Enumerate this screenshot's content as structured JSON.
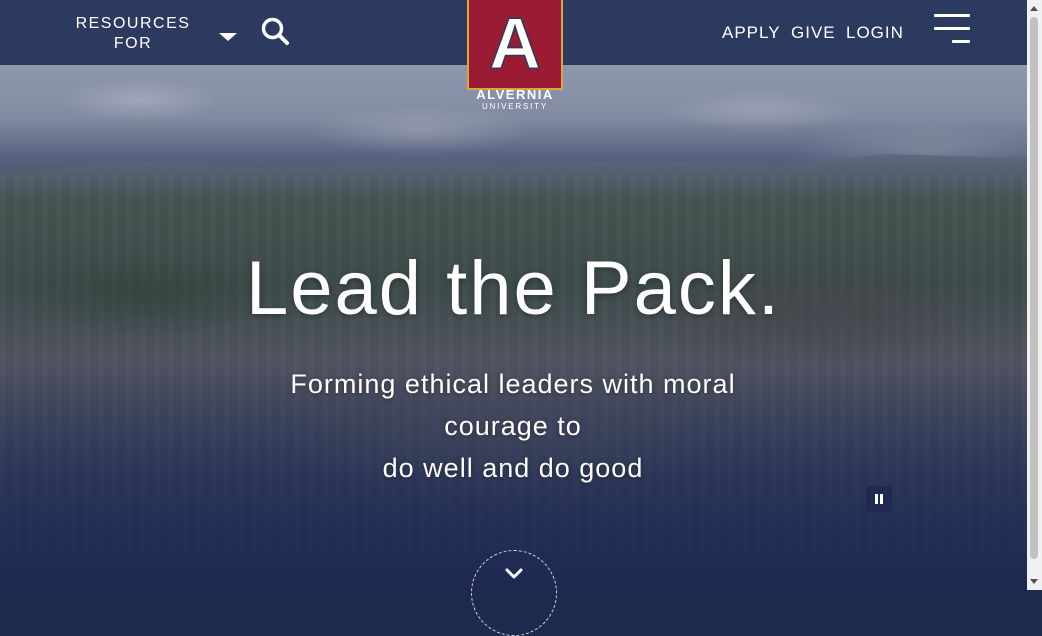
{
  "header": {
    "resources_label": "RESOURCES FOR",
    "nav": [
      {
        "label": "APPLY"
      },
      {
        "label": "GIVE"
      },
      {
        "label": "LOGIN"
      }
    ]
  },
  "logo": {
    "letter": "A",
    "name": "ALVERNIA",
    "subtitle": "UNIVERSITY",
    "colors": {
      "box": "#9b1b32",
      "border": "#d8a93a"
    }
  },
  "hero": {
    "headline": "Lead the Pack.",
    "tagline_line1": "Forming ethical leaders with moral",
    "tagline_line2": "courage to",
    "tagline_line3": "do well and do good"
  },
  "icons": {
    "search": "search-icon",
    "menu": "hamburger-menu-icon",
    "pause": "pause-icon",
    "scroll": "chevron-down-icon"
  },
  "colors": {
    "topbar": "#2c3a60",
    "text": "#ffffff"
  }
}
